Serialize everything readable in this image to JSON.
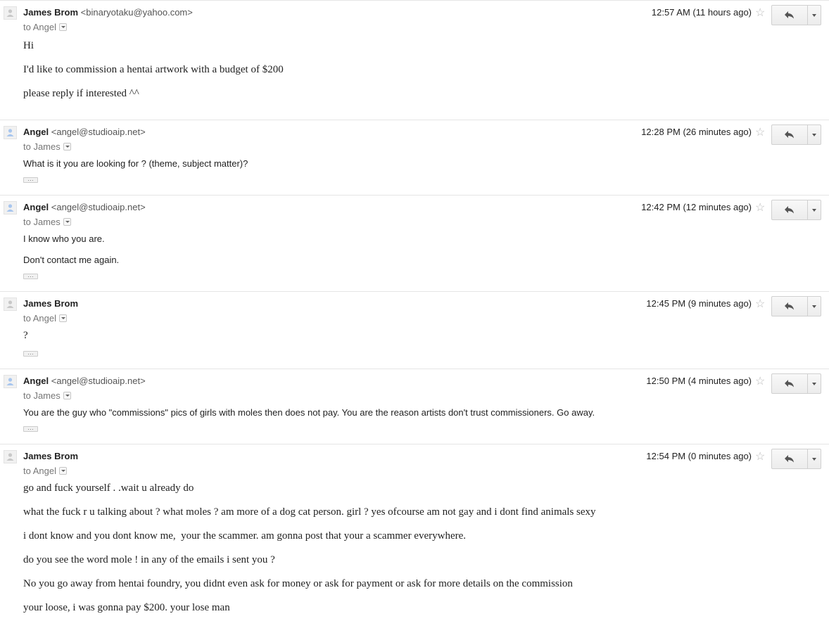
{
  "messages": [
    {
      "sender": "James Brom",
      "email": "<binaryotaku@yahoo.com>",
      "to": "to Angel",
      "time": "12:57 AM (11 hours ago)",
      "avatar_color": "#c8c8c8",
      "lines": [
        "Hi",
        "I'd like to commission a hentai artwork with a budget of $200",
        "please reply if interested ^^"
      ]
    },
    {
      "sender": "Angel",
      "email": "<angel@studioaip.net>",
      "to": "to James",
      "time": "12:28 PM (26 minutes ago)",
      "avatar_color": "#a8c6ee",
      "lines": [
        "What is it you are looking for ? (theme, subject matter)?"
      ]
    },
    {
      "sender": "Angel",
      "email": "<angel@studioaip.net>",
      "to": "to James",
      "time": "12:42 PM (12 minutes ago)",
      "avatar_color": "#a8c6ee",
      "lines": [
        "I know who you are.",
        "Don't contact me again."
      ]
    },
    {
      "sender": "James Brom",
      "email": "",
      "to": "to Angel",
      "time": "12:45 PM (9 minutes ago)",
      "avatar_color": "#c8c8c8",
      "lines": [
        "?"
      ]
    },
    {
      "sender": "Angel",
      "email": "<angel@studioaip.net>",
      "to": "to James",
      "time": "12:50 PM (4 minutes ago)",
      "avatar_color": "#a8c6ee",
      "lines": [
        "You are the guy who \"commissions\" pics of girls with moles then does not pay. You are the reason artists don't trust commissioners. Go away."
      ]
    },
    {
      "sender": "James Brom",
      "email": "",
      "to": "to Angel",
      "time": "12:54 PM (0 minutes ago)",
      "avatar_color": "#c8c8c8",
      "lines": [
        "go and fuck yourself . .wait u already do",
        "what the fuck r u talking about ? what moles ? am more of a dog cat person. girl ? yes ofcourse am not gay and i dont find animals sexy",
        "i dont know and you dont know me,  your the scammer. am gonna post that your a scammer everywhere.",
        "do you see the word mole ! in any of the emails i sent you ?",
        "No you go away from hentai foundry, you didnt even ask for money or ask for payment or ask for more details on the commission",
        "your loose, i was gonna pay $200. your lose man"
      ]
    }
  ],
  "quoted_text_toggle": "…"
}
